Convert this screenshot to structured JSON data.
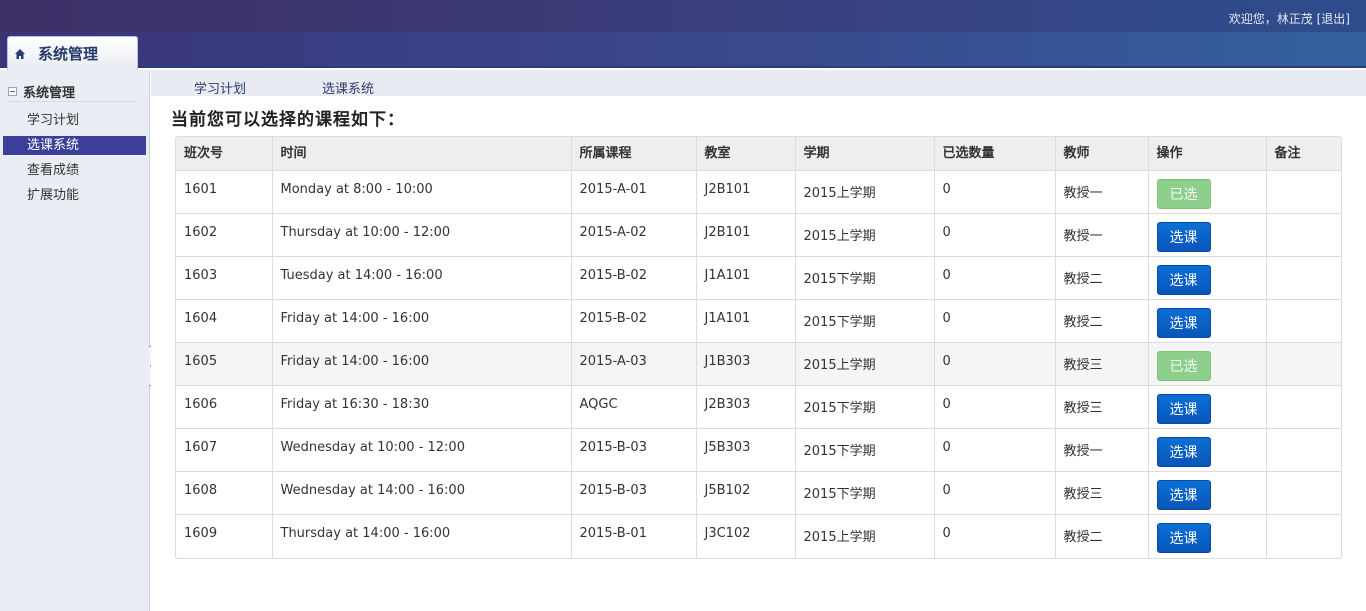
{
  "header": {
    "welcome": "欢迎您，林正茂",
    "logout": "[退出]"
  },
  "nav": {
    "system_tab": "系统管理"
  },
  "sidebar": {
    "title": "系统管理",
    "items": [
      {
        "label": "学习计划",
        "active": false
      },
      {
        "label": "选课系统",
        "active": true
      },
      {
        "label": "查看成绩",
        "active": false
      },
      {
        "label": "扩展功能",
        "active": false
      }
    ]
  },
  "subtabs": [
    "学习计划",
    "选课系统"
  ],
  "main": {
    "title": "当前您可以选择的课程如下：",
    "columns": [
      "班次号",
      "时间",
      "所属课程",
      "教室",
      "学期",
      "已选数量",
      "教师",
      "操作",
      "备注"
    ],
    "rows": [
      {
        "id": "1601",
        "time": "Monday at 8:00 - 10:00",
        "course": "2015-A-01",
        "room": "J2B101",
        "term": "2015上学期",
        "count": "0",
        "teacher": "教授一",
        "action": "已选",
        "selected": true,
        "note": ""
      },
      {
        "id": "1602",
        "time": "Thursday at 10:00 - 12:00",
        "course": "2015-A-02",
        "room": "J2B101",
        "term": "2015上学期",
        "count": "0",
        "teacher": "教授一",
        "action": "选课",
        "selected": false,
        "note": ""
      },
      {
        "id": "1603",
        "time": "Tuesday at 14:00 - 16:00",
        "course": "2015-B-02",
        "room": "J1A101",
        "term": "2015下学期",
        "count": "0",
        "teacher": "教授二",
        "action": "选课",
        "selected": false,
        "note": ""
      },
      {
        "id": "1604",
        "time": "Friday at 14:00 - 16:00",
        "course": "2015-B-02",
        "room": "J1A101",
        "term": "2015下学期",
        "count": "0",
        "teacher": "教授二",
        "action": "选课",
        "selected": false,
        "note": ""
      },
      {
        "id": "1605",
        "time": "Friday at 14:00 - 16:00",
        "course": "2015-A-03",
        "room": "J1B303",
        "term": "2015上学期",
        "count": "0",
        "teacher": "教授三",
        "action": "已选",
        "selected": true,
        "note": ""
      },
      {
        "id": "1606",
        "time": "Friday at 16:30 - 18:30",
        "course": "AQGC",
        "room": "J2B303",
        "term": "2015下学期",
        "count": "0",
        "teacher": "教授三",
        "action": "选课",
        "selected": false,
        "note": ""
      },
      {
        "id": "1607",
        "time": "Wednesday at 10:00 - 12:00",
        "course": "2015-B-03",
        "room": "J5B303",
        "term": "2015下学期",
        "count": "0",
        "teacher": "教授一",
        "action": "选课",
        "selected": false,
        "note": ""
      },
      {
        "id": "1608",
        "time": "Wednesday at 14:00 - 16:00",
        "course": "2015-B-03",
        "room": "J5B102",
        "term": "2015下学期",
        "count": "0",
        "teacher": "教授三",
        "action": "选课",
        "selected": false,
        "note": ""
      },
      {
        "id": "1609",
        "time": "Thursday at 14:00 - 16:00",
        "course": "2015-B-01",
        "room": "J3C102",
        "term": "2015上学期",
        "count": "0",
        "teacher": "教授二",
        "action": "选课",
        "selected": false,
        "note": ""
      }
    ]
  }
}
